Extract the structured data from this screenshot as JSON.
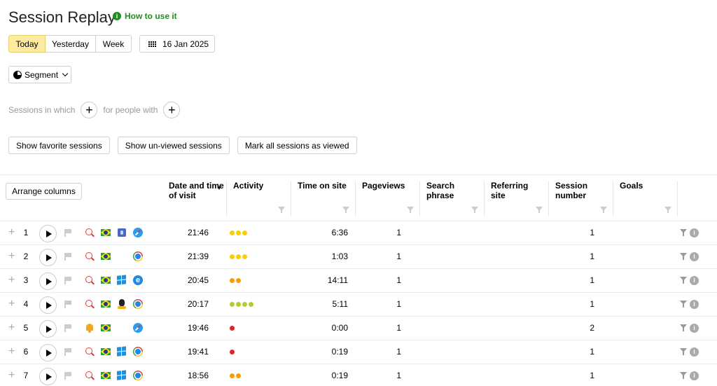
{
  "page": {
    "title": "Session Replay",
    "how_to_label": "How to use it",
    "how_to_icon": "info-circle-icon"
  },
  "periods": [
    {
      "label": "Today",
      "active": true
    },
    {
      "label": "Yesterday",
      "active": false
    },
    {
      "label": "Week",
      "active": false
    }
  ],
  "date_picker": {
    "icon": "calendar-icon",
    "label": "16 Jan 2025"
  },
  "segment": {
    "icon": "pie-chart-icon",
    "label": "Segment"
  },
  "filters": {
    "sessions_label": "Sessions in which",
    "people_label": "for people with",
    "add_symbol": "+"
  },
  "actions": {
    "show_favorites": "Show favorite sessions",
    "show_unviewed": "Show un-viewed sessions",
    "mark_viewed": "Mark all sessions as viewed"
  },
  "table": {
    "arrange_label": "Arrange columns",
    "sort_indicator": "▼",
    "columns": [
      "Date and time of visit",
      "Activity",
      "Time on site",
      "Pageviews",
      "Search phrase",
      "Referring site",
      "Session number",
      "Goals"
    ],
    "activity_colors": {
      "yellow": "#ffcc00",
      "orange": "#ff9900",
      "green": "#b5cc2e",
      "red": "#e52222"
    },
    "rows": [
      {
        "n": "1",
        "source": "search",
        "os": "mac",
        "browser": "safari",
        "time": "21:46",
        "activity": [
          "yellow",
          "yellow",
          "yellow"
        ],
        "time_on_site": "6:36",
        "pageviews": "1",
        "session_number": "1"
      },
      {
        "n": "2",
        "source": "search",
        "os": "",
        "browser": "chrome",
        "time": "21:39",
        "activity": [
          "yellow",
          "yellow",
          "yellow"
        ],
        "time_on_site": "1:03",
        "pageviews": "1",
        "session_number": "1"
      },
      {
        "n": "3",
        "source": "search",
        "os": "windows",
        "browser": "edge",
        "time": "20:45",
        "activity": [
          "orange",
          "orange"
        ],
        "time_on_site": "14:11",
        "pageviews": "1",
        "session_number": "1"
      },
      {
        "n": "4",
        "source": "search",
        "os": "linux",
        "browser": "chrome",
        "time": "20:17",
        "activity": [
          "green",
          "green",
          "green",
          "green"
        ],
        "time_on_site": "5:11",
        "pageviews": "1",
        "session_number": "1"
      },
      {
        "n": "5",
        "source": "notification",
        "os": "",
        "browser": "safari",
        "time": "19:46",
        "activity": [
          "red"
        ],
        "time_on_site": "0:00",
        "pageviews": "1",
        "session_number": "2"
      },
      {
        "n": "6",
        "source": "search",
        "os": "windows",
        "browser": "chrome",
        "time": "19:41",
        "activity": [
          "red"
        ],
        "time_on_site": "0:19",
        "pageviews": "1",
        "session_number": "1"
      },
      {
        "n": "7",
        "source": "search",
        "os": "windows",
        "browser": "chrome",
        "time": "18:56",
        "activity": [
          "orange",
          "orange"
        ],
        "time_on_site": "0:19",
        "pageviews": "1",
        "session_number": "1"
      }
    ]
  }
}
